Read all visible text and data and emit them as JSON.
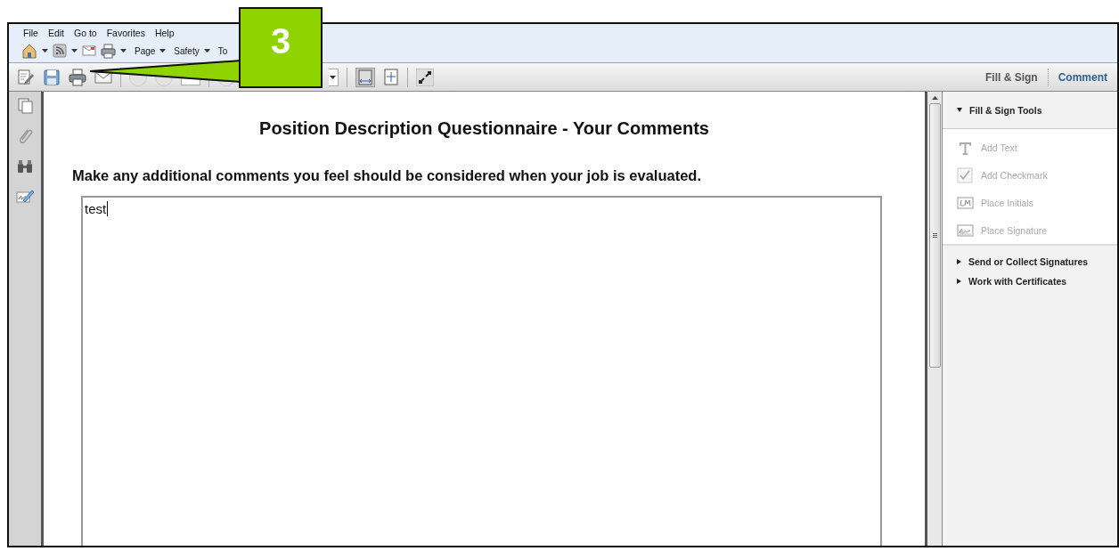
{
  "menu": [
    {
      "label": "File"
    },
    {
      "label": "Edit"
    },
    {
      "label": "Go to"
    },
    {
      "label": "Favorites"
    },
    {
      "label": "Help"
    }
  ],
  "command_bar": [
    {
      "kind": "home"
    },
    {
      "kind": "feed"
    },
    {
      "kind": "mail"
    },
    {
      "kind": "print"
    },
    {
      "kind": "menu",
      "label": "Page"
    },
    {
      "kind": "menu",
      "label": "Safety"
    },
    {
      "kind": "text",
      "label": "To"
    }
  ],
  "panel_tabs": [
    {
      "label": "Fill & Sign",
      "selected": true
    },
    {
      "label": "Comment",
      "selected": false
    }
  ],
  "document": {
    "title": "Position Description Questionnaire - Your Comments",
    "prompt": "Make any additional comments you feel should be considered when your job is evaluated.",
    "answer": "test"
  },
  "tools_pane": {
    "header": {
      "label": "Fill & Sign Tools",
      "expanded": true
    },
    "tools": [
      {
        "kind": "text",
        "label": "Add Text",
        "disabled": true
      },
      {
        "kind": "checkmark",
        "label": "Add Checkmark",
        "disabled": true
      },
      {
        "kind": "initials",
        "label": "Place Initials",
        "disabled": true
      },
      {
        "kind": "signature",
        "label": "Place Signature",
        "disabled": true
      }
    ],
    "sections": [
      {
        "label": "Send or Collect Signatures",
        "expanded": false
      },
      {
        "label": "Work with Certificates",
        "expanded": false
      }
    ]
  },
  "callout": {
    "number": "3"
  }
}
